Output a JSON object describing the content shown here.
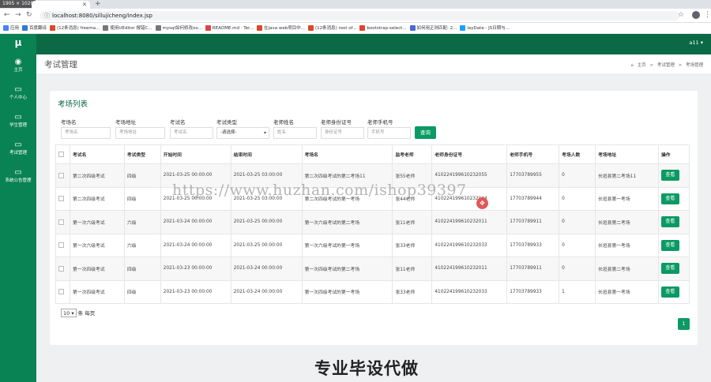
{
  "browser": {
    "dimensions": "1905 × 1029",
    "url": "localhost:8080/sillujicheng/index.jsp",
    "bookmarks": [
      {
        "label": "应用",
        "color": "#4285f4"
      },
      {
        "label": "百度翻译",
        "color": "#2f7bd1"
      },
      {
        "label": "(12条消息) freema...",
        "color": "#e0452a"
      },
      {
        "label": "使用UEditor 报错C...",
        "color": "#777777"
      },
      {
        "label": "mysql如何修改oo...",
        "color": "#777777"
      },
      {
        "label": "README.md · Ter...",
        "color": "#d44"
      },
      {
        "label": "在java web项目中...",
        "color": "#e0452a"
      },
      {
        "label": "(12条消息) root of...",
        "color": "#e0452a"
      },
      {
        "label": "bootstrap-select...",
        "color": "#e0452a"
      },
      {
        "label": "如何用正则匹配: 2...",
        "color": "#4a6ad1"
      },
      {
        "label": "layDate - JS日期与...",
        "color": "#1e9fff"
      }
    ]
  },
  "sidebar": {
    "logo": "μ",
    "items": [
      {
        "icon": "dashboard-icon",
        "glyph": "◉",
        "label": "主页"
      },
      {
        "icon": "monitor-icon",
        "glyph": "▭",
        "label": "个人中心"
      },
      {
        "icon": "monitor-icon",
        "glyph": "▭",
        "label": "学生管理"
      },
      {
        "icon": "monitor-icon",
        "glyph": "▭",
        "label": "考试管理"
      },
      {
        "icon": "monitor-icon",
        "glyph": "▭",
        "label": "系统公告管理"
      }
    ]
  },
  "header": {
    "user": "a11 ▾"
  },
  "page": {
    "title": "考试管理",
    "breadcrumb": [
      "主页",
      ">",
      "考试管理",
      ">",
      "考场管理"
    ]
  },
  "panel": {
    "title": "考场列表",
    "filters": [
      {
        "label": "考场名",
        "placeholder": "考场名"
      },
      {
        "label": "考场地址",
        "placeholder": "考场地址"
      },
      {
        "label": "考试名",
        "placeholder": "考试名"
      },
      {
        "label": "考试类型",
        "select": "-请选择-"
      },
      {
        "label": "老师姓名",
        "placeholder": "姓名"
      },
      {
        "label": "老师身份证号",
        "placeholder": "身份证号"
      },
      {
        "label": "老师手机号",
        "placeholder": "手机号"
      }
    ],
    "search_label": "查询",
    "columns": [
      "考试名",
      "考试类型",
      "开始时间",
      "结束时间",
      "考场名",
      "监考老师",
      "老师身份证号",
      "老师手机号",
      "考场人数",
      "考场地址",
      "操作"
    ],
    "rows": [
      [
        "第二次四级考试",
        "四级",
        "2021-03-25 00:00:00",
        "2021-03-25 03:00:00",
        "第二次四级考试的第二考场11",
        "张55老师",
        "410224199610232055",
        "17703789955",
        "0",
        "长垣县第二考场11"
      ],
      [
        "第二次四级考试",
        "四级",
        "2021-03-25 00:00:00",
        "2021-03-25 03:00:00",
        "第二次四级考试的第一考场",
        "张44老师",
        "410224199610232044",
        "17703789944",
        "0",
        "长垣县第一考场"
      ],
      [
        "第一次六级考试",
        "六级",
        "2021-03-24 00:00:00",
        "2021-03-25 00:00:00",
        "第一次六级考试的第二考场",
        "张11老师",
        "410224199610232011",
        "17703789911",
        "0",
        "长垣县第二考场"
      ],
      [
        "第一次六级考试",
        "六级",
        "2021-03-24 00:00:00",
        "2021-03-25 00:00:00",
        "第一次六级考试的第一考场",
        "张33老师",
        "410224199610232033",
        "17703789933",
        "0",
        "长垣县第一考场"
      ],
      [
        "第一次四级考试",
        "四级",
        "2021-03-23 00:00:00",
        "2021-03-24 00:00:00",
        "第一次四级考试的第二考场",
        "张11老师",
        "410224199610232011",
        "17703789911",
        "0",
        "长垣县第二考场"
      ],
      [
        "第一次四级考试",
        "四级",
        "2021-03-23 00:00:00",
        "2021-03-24 00:00:00",
        "第一次四级考试的第一考场",
        "张33老师",
        "410224199610232033",
        "17703789933",
        "1",
        "长垣县第一考场"
      ]
    ],
    "view_label": "查看",
    "page_size": "10",
    "page_size_suffix": "条 每页",
    "current_page": "1"
  },
  "overlay": {
    "watermark": "https://www.huzhan.com/ishop39397",
    "banner": "专业毕设代做"
  },
  "colors": {
    "sidebar": "#098354",
    "header": "#0b6a45",
    "accent": "#0b9a64"
  }
}
